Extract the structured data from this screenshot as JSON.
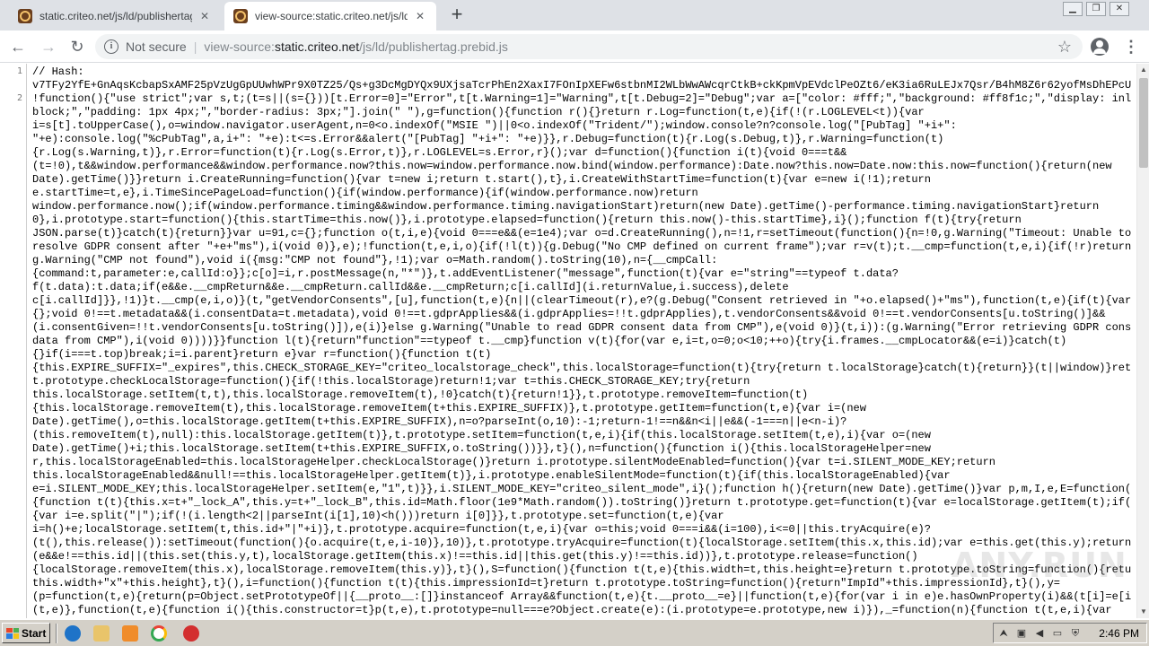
{
  "browser": {
    "tabs": [
      {
        "title": "static.criteo.net/js/ld/publishertag.p",
        "active": false
      },
      {
        "title": "view-source:static.criteo.net/js/ld/p",
        "active": true
      }
    ],
    "security_label": "Not secure",
    "url_scheme": "view-source:",
    "url_host": "static.criteo.net",
    "url_path": "/js/ld/publishertag.prebid.js"
  },
  "source": {
    "line_numbers": [
      "1",
      "2"
    ],
    "lines": [
      "// Hash:",
      "v7TFy2YfE+GnAqsKcbapSxAMF25pVzUgGpUUwhWPr9X0TZ25/Qs+g3DcMgDYQx9UXjsaTcrPhEn2XaxI7FOnIpXEFw6stbnMI2WLbWwAWcqrCtkB+ckKpmVpEVdclPeOZt6/eK3ia6RuLEJx7Qsr/B4hM8Z6r62yofMsDhEPcUs=",
      "!function(){\"use strict\";var s,t;(t=s||(s={}))[t.Error=0]=\"Error\",t[t.Warning=1]=\"Warning\",t[t.Debug=2]=\"Debug\";var a=[\"color: #fff;\",\"background: #ff8f1c;\",\"display: inline-",
      "block;\",\"padding: 1px 4px;\",\"border-radius: 3px;\"].join(\" \"),g=function(){function r(){}return r.Log=function(t,e){if(!(r.LOGLEVEL<t)){var",
      "i=s[t].toUpperCase(),o=window.navigator.userAgent,n=0<o.indexOf(\"MSIE \")||0<o.indexOf(\"Trident/\");window.console?n?console.log(\"[PubTag] \"+i+\":",
      "\"+e):console.log(\"%cPubTag\",a,i+\": \"+e):t<=s.Error&&alert(\"[PubTag] \"+i+\": \"+e)}},r.Debug=function(t){r.Log(s.Debug,t)},r.Warning=function(t)",
      "{r.Log(s.Warning,t)},r.Error=function(t){r.Log(s.Error,t)},r.LOGLEVEL=s.Error,r}();var d=function(){function i(t){void 0===t&&",
      "(t=!0),t&&window.performance&&window.performance.now?this.now=window.performance.now.bind(window.performance):Date.now?this.now=Date.now:this.now=function(){return(new",
      "Date).getTime()}}return i.CreateRunning=function(){var t=new i;return t.start(),t},i.CreateWithStartTime=function(t){var e=new i(!1);return",
      "e.startTime=t,e},i.TimeSincePageLoad=function(){if(window.performance){if(window.performance.now)return",
      "window.performance.now();if(window.performance.timing&&window.performance.timing.navigationStart)return(new Date).getTime()-performance.timing.navigationStart}return",
      "0},i.prototype.start=function(){this.startTime=this.now()},i.prototype.elapsed=function(){return this.now()-this.startTime},i}();function f(t){try{return",
      "JSON.parse(t)}catch(t){return}}var u=91,c={};function o(t,i,e){void 0===e&&(e=1e4);var o=d.CreateRunning(),n=!1,r=setTimeout(function(){n=!0,g.Warning(\"Timeout: Unable to",
      "resolve GDPR consent after \"+e+\"ms\"),i(void 0)},e);!function(t,e,i,o){if(!l(t)){g.Debug(\"No CMP defined on current frame\");var r=v(t);t.__cmp=function(t,e,i){if(!r)return",
      "g.Warning(\"CMP not found\"),void i({msg:\"CMP not found\"},!1);var o=Math.random().toString(10),n={__cmpCall:",
      "{command:t,parameter:e,callId:o}};c[o]=i,r.postMessage(n,\"*\")},t.addEventListener(\"message\",function(t){var e=\"string\"==typeof t.data?",
      "f(t.data):t.data;if(e&&e.__cmpReturn&&e.__cmpReturn.callId&&e.__cmpReturn;c[i.callId](i.returnValue,i.success),delete",
      "c[i.callId]}},!1)}t.__cmp(e,i,o)}(t,\"getVendorConsents\",[u],function(t,e){n||(clearTimeout(r),e?(g.Debug(\"Consent retrieved in \"+o.elapsed()+\"ms\"),function(t,e){if(t){var i=",
      "{};void 0!==t.metadata&&(i.consentData=t.metadata),void 0!==t.gdprApplies&&(i.gdprApplies=!!t.gdprApplies),t.vendorConsents&&void 0!==t.vendorConsents[u.toString()]&&",
      "(i.consentGiven=!!t.vendorConsents[u.toString()]),e(i)}else g.Warning(\"Unable to read GDPR consent data from CMP\"),e(void 0)}(t,i)):(g.Warning(\"Error retrieving GDPR consent",
      "data from CMP\"),i(void 0))))}}function l(t){return\"function\"==typeof t.__cmp}function v(t){for(var e,i=t,o=0;o<10;++o){try{i.frames.__cmpLocator&&(e=i)}catch(t)",
      "{}if(i===t.top)break;i=i.parent}return e}var r=function(){function t(t)",
      "{this.EXPIRE_SUFFIX=\"_expires\",this.CHECK_STORAGE_KEY=\"criteo_localstorage_check\",this.localStorage=function(t){try{return t.localStorage}catch(t){return}}(t||window)}return",
      "t.prototype.checkLocalStorage=function(){if(!this.localStorage)return!1;var t=this.CHECK_STORAGE_KEY;try{return",
      "this.localStorage.setItem(t,t),this.localStorage.removeItem(t),!0}catch(t){return!1}},t.prototype.removeItem=function(t)",
      "{this.localStorage.removeItem(t),this.localStorage.removeItem(t+this.EXPIRE_SUFFIX)},t.prototype.getItem=function(t,e){var i=(new",
      "Date).getTime(),o=this.localStorage.getItem(t+this.EXPIRE_SUFFIX),n=o?parseInt(o,10):-1;return-1!==n&&n<i||e&&(-1===n||e<n-i)?",
      "(this.removeItem(t),null):this.localStorage.getItem(t)},t.prototype.setItem=function(t,e,i){if(this.localStorage.setItem(t,e),i){var o=(new",
      "Date).getTime()+i;this.localStorage.setItem(t+this.EXPIRE_SUFFIX,o.toString())}},t}(),n=function(){function i(){this.localStorageHelper=new",
      "r,this.localStorageEnabled=this.localStorageHelper.checkLocalStorage()}return i.prototype.silentModeEnabled=function(){var t=i.SILENT_MODE_KEY;return",
      "this.localStorageEnabled&&null!==this.localStorageHelper.getItem(t)},i.prototype.enableSilentMode=function(t){if(this.localStorageEnabled){var",
      "e=i.SILENT_MODE_KEY;this.localStorageHelper.setItem(e,\"1\",t)}},i.SILENT_MODE_KEY=\"criteo_silent_mode\",i}();function h(){return(new Date).getTime()}var p,m,I,e,E=function()",
      "{function t(t){this.x=t+\"_lock_A\",this.y=t+\"_lock_B\",this.id=Math.floor(1e9*Math.random()).toString()}return t.prototype.get=function(t){var e=localStorage.getItem(t);if(e)",
      "{var i=e.split(\"|\");if(!(i.length<2||parseInt(i[1],10)<h()))return i[0]}},t.prototype.set=function(t,e){var",
      "i=h()+e;localStorage.setItem(t,this.id+\"|\"+i)},t.prototype.acquire=function(t,e,i){var o=this;void 0===i&&(i=100),i<=0||this.tryAcquire(e)?",
      "(t(),this.release()):setTimeout(function(){o.acquire(t,e,i-10)},10)},t.prototype.tryAcquire=function(t){localStorage.setItem(this.x,this.id);var e=this.get(this.y);return!",
      "(e&&e!==this.id||(this.set(this.y,t),localStorage.getItem(this.x)!==this.id||this.get(this.y)!==this.id))},t.prototype.release=function()",
      "{localStorage.removeItem(this.x),localStorage.removeItem(this.y)},t}(),S=function(){function t(t,e){this.width=t,this.height=e}return t.prototype.toString=function(){return",
      "this.width+\"x\"+this.height},t}(),i=function(){function t(t){this.impressionId=t}return t.prototype.toString=function(){return\"ImpId\"+this.impressionId},t}(),y=",
      "(p=function(t,e){return(p=Object.setPrototypeOf||{__proto__:[]}instanceof Array&&function(t,e){t.__proto__=e}||function(t,e){for(var i in e)e.hasOwnProperty(i)&&(t[i]=e[i])})",
      "(t,e)},function(t,e){function i(){this.constructor=t}p(t,e),t.prototype=null===e?Object.create(e):(i.prototype=e.prototype,new i)}),_=function(n){function t(t,e,i){var"
    ]
  },
  "watermark": "ANY.RUN",
  "taskbar": {
    "start_label": "Start",
    "clock": "2:46 PM"
  },
  "colors": {
    "tab_bar": "#dee1e6",
    "omnibox": "#f1f3f4",
    "taskbar": "#d4d0c8"
  }
}
